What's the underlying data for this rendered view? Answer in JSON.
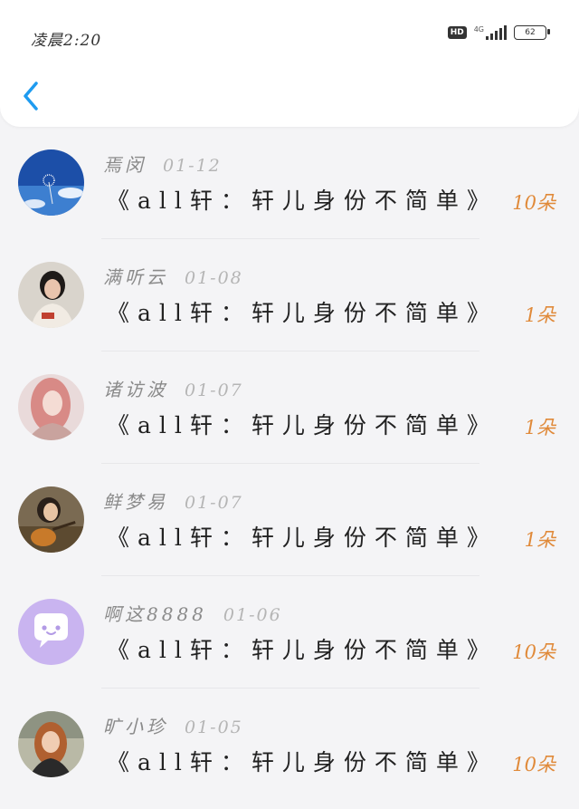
{
  "status_bar": {
    "time": "凌晨2:20",
    "hd": "HD",
    "network": "4G",
    "battery": "62"
  },
  "rows": [
    {
      "name": "焉闵",
      "date": "01-12",
      "message": "《all轩：轩儿身份不简单》",
      "count": "10朵"
    },
    {
      "name": "满听云",
      "date": "01-08",
      "message": "《all轩：轩儿身份不简单》",
      "count": "1朵"
    },
    {
      "name": "诸访波",
      "date": "01-07",
      "message": "《all轩：轩儿身份不简单》",
      "count": "1朵"
    },
    {
      "name": "鲜梦易",
      "date": "01-07",
      "message": "《all轩：轩儿身份不简单》",
      "count": "1朵"
    },
    {
      "name": "啊这8888",
      "date": "01-06",
      "message": "《all轩：轩儿身份不简单》",
      "count": "10朵"
    },
    {
      "name": "旷小珍",
      "date": "01-05",
      "message": "《all轩：轩儿身份不简单》",
      "count": "10朵"
    }
  ],
  "colors": {
    "accent": "#1e9bf0",
    "count": "#e08a3a"
  }
}
